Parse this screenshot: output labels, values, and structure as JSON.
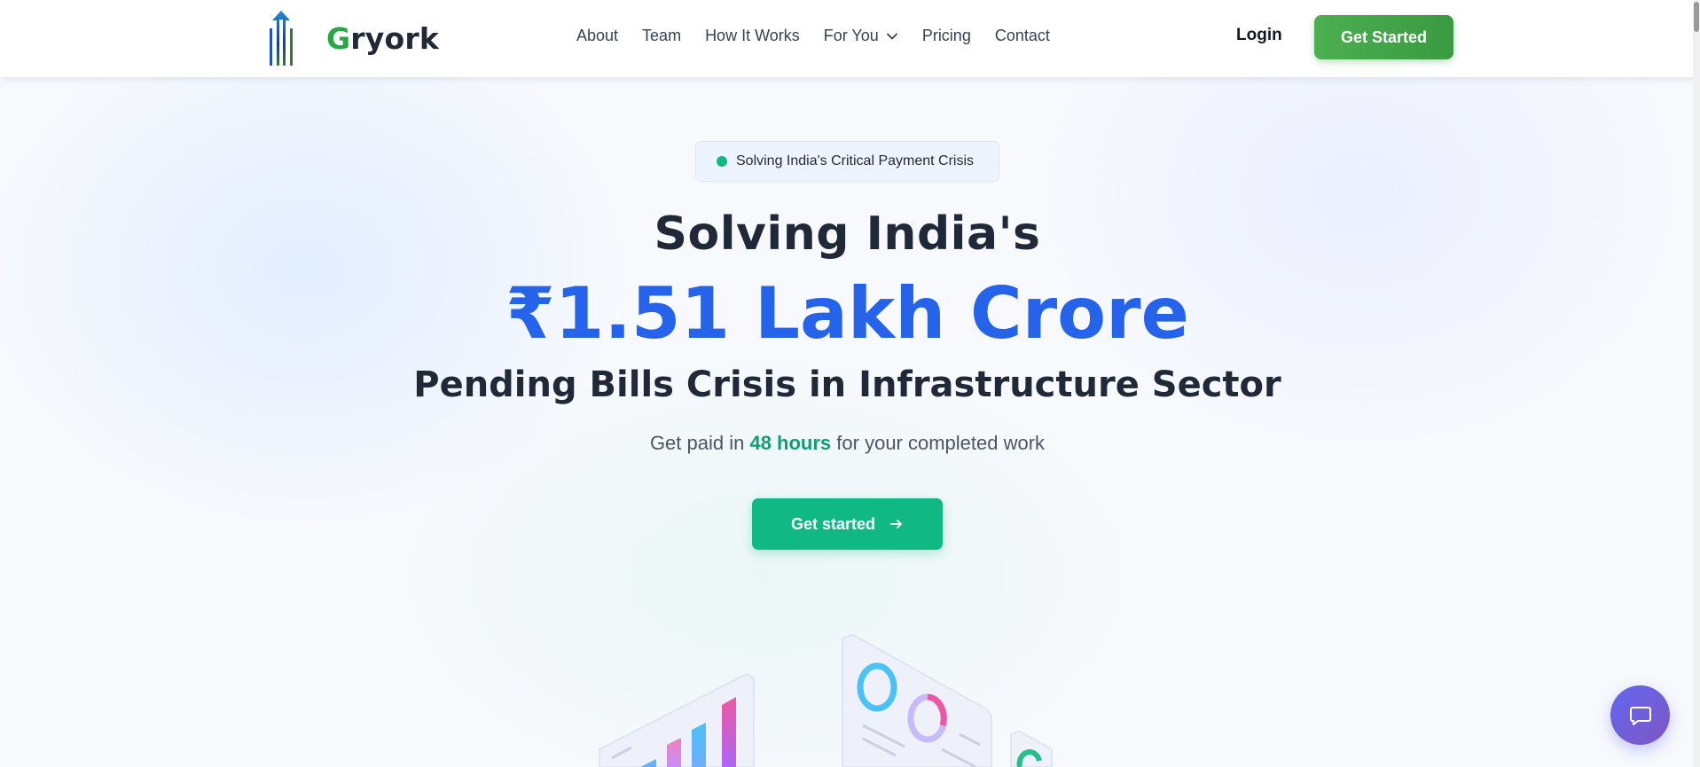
{
  "brand": {
    "name_first": "G",
    "name_rest": "ryork",
    "accent": "#28a745"
  },
  "nav": {
    "items": [
      {
        "label": "About"
      },
      {
        "label": "Team"
      },
      {
        "label": "How It Works"
      },
      {
        "label": "For You",
        "has_dropdown": true
      },
      {
        "label": "Pricing"
      },
      {
        "label": "Contact"
      }
    ],
    "login_label": "Login",
    "cta_label": "Get Started"
  },
  "hero": {
    "badge_text": "Solving India's Critical Payment Crisis",
    "line1": "Solving India's",
    "line2": "₹1.51 Lakh Crore",
    "line3": "Pending Bills Crisis in Infrastructure Sector",
    "sub_pre": "Get paid in",
    "sub_highlight": "48 hours",
    "sub_post": "for your completed work",
    "cta_label": "Get started"
  },
  "colors": {
    "primary_blue": "#2563eb",
    "hero_green": "#10b981",
    "nav_green": "#4caf50",
    "chat_purple": "#6366f1"
  },
  "icons": {
    "dropdown": "chevron-down-icon",
    "cta_arrow": "arrow-right-icon",
    "chat": "chat-bubble-icon",
    "badge_dot": "status-dot-icon"
  }
}
